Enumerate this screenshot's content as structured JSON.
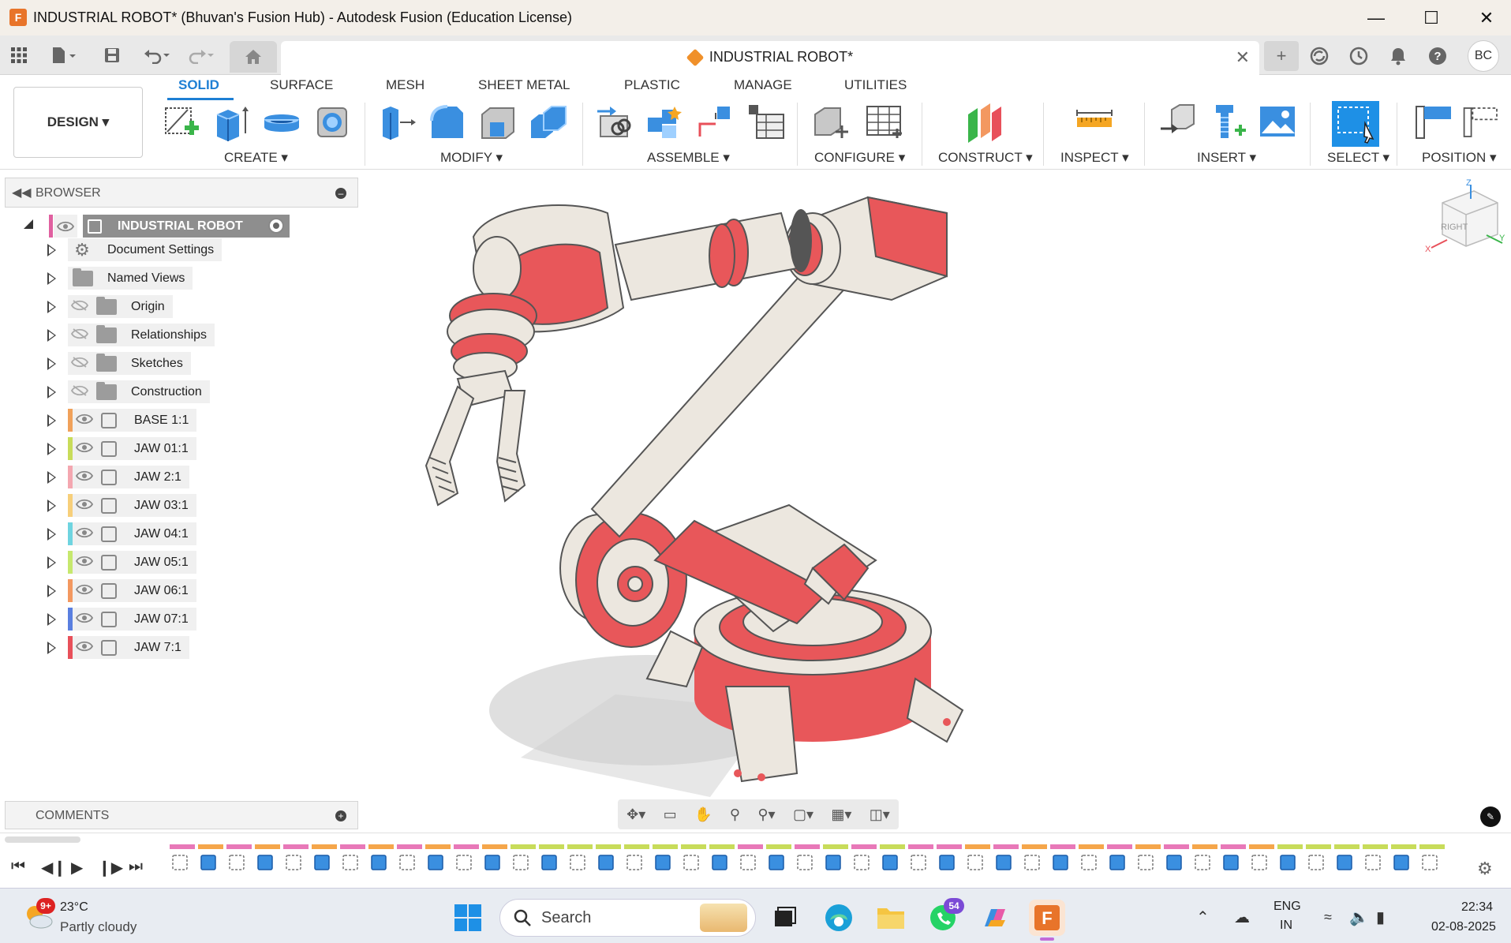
{
  "window": {
    "title": "INDUSTRIAL ROBOT* (Bhuvan's Fusion Hub) - Autodesk Fusion (Education License)",
    "app_icon_letter": "F"
  },
  "document_tab": {
    "title": "INDUSTRIAL ROBOT*"
  },
  "user": {
    "initials": "BC"
  },
  "workspace": {
    "label": "DESIGN ▾"
  },
  "ribbon": {
    "tabs": [
      "SOLID",
      "SURFACE",
      "MESH",
      "SHEET METAL",
      "PLASTIC",
      "MANAGE",
      "UTILITIES"
    ],
    "active_tab": "SOLID",
    "groups": [
      "CREATE ▾",
      "MODIFY ▾",
      "ASSEMBLE ▾",
      "CONFIGURE ▾",
      "CONSTRUCT ▾",
      "INSPECT ▾",
      "INSERT ▾",
      "SELECT ▾",
      "POSITION ▾"
    ]
  },
  "browser": {
    "title": "BROWSER",
    "root": "INDUSTRIAL ROBOT",
    "items": [
      {
        "label": "Document Settings",
        "kind": "settings"
      },
      {
        "label": "Named Views",
        "kind": "folder"
      },
      {
        "label": "Origin",
        "kind": "folder-hidden"
      },
      {
        "label": "Relationships",
        "kind": "folder-hidden"
      },
      {
        "label": "Sketches",
        "kind": "folder-hidden"
      },
      {
        "label": "Construction",
        "kind": "folder-hidden"
      },
      {
        "label": "BASE 1:1",
        "kind": "component",
        "color": "#f0a15a"
      },
      {
        "label": "JAW 01:1",
        "kind": "component",
        "color": "#c8dc5a"
      },
      {
        "label": "JAW 2:1",
        "kind": "component",
        "color": "#f4a7b0"
      },
      {
        "label": "JAW 03:1",
        "kind": "component",
        "color": "#f7cf7a"
      },
      {
        "label": "JAW 04:1",
        "kind": "component",
        "color": "#6fd4e0"
      },
      {
        "label": "JAW 05:1",
        "kind": "component",
        "color": "#c6e86e"
      },
      {
        "label": "JAW 06:1",
        "kind": "component",
        "color": "#f39860"
      },
      {
        "label": "JAW 07:1",
        "kind": "component",
        "color": "#5a7fe0"
      },
      {
        "label": "JAW 7:1",
        "kind": "component",
        "color": "#e8505a"
      }
    ]
  },
  "comments": {
    "title": "COMMENTS"
  },
  "viewcube": {
    "face": "RIGHT",
    "axis_z": "Z",
    "axis_x": "X",
    "axis_y": "Y"
  },
  "taskbar": {
    "weather_temp": "23°C",
    "weather_desc": "Partly cloudy",
    "weather_badge": "9+",
    "search_placeholder": "Search",
    "whatsapp_badge": "54",
    "lang_top": "ENG",
    "lang_bottom": "IN",
    "time": "22:34",
    "date": "02-08-2025"
  },
  "colors": {
    "accent": "#1e7fd4",
    "robot_red": "#e8575a",
    "robot_cream": "#ece7df"
  }
}
